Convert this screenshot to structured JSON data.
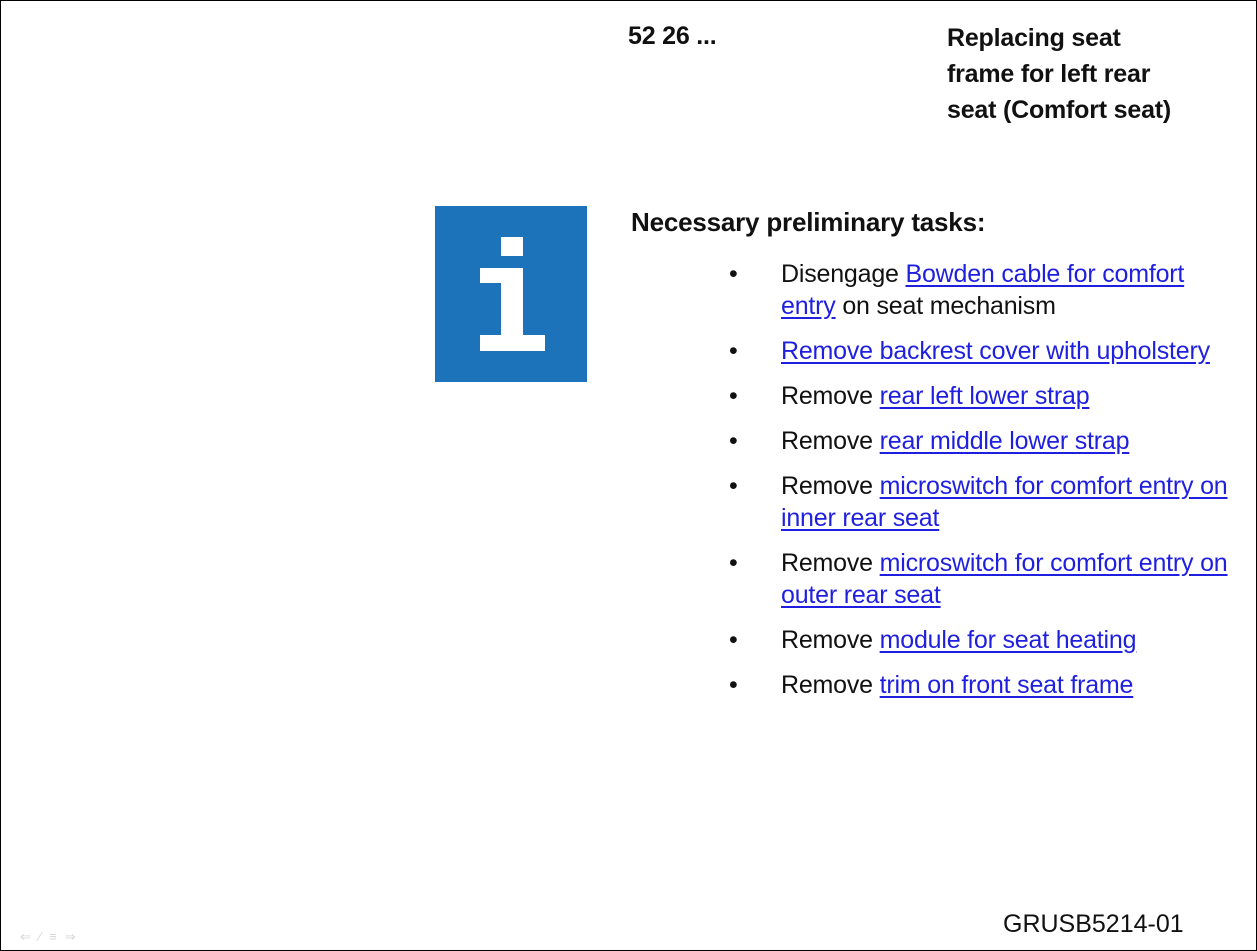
{
  "header": {
    "code": "52 26 ...",
    "title_lines": [
      "Replacing seat",
      "frame for left rear",
      "seat (Comfort seat)"
    ]
  },
  "section": {
    "heading": "Necessary preliminary tasks:",
    "info_icon": "info-icon",
    "bullet": "•",
    "tasks": [
      {
        "prefix": "Disengage ",
        "link": "Bowden cable for comfort entry",
        "suffix": " on seat mechanism"
      },
      {
        "prefix": "",
        "link": "Remove backrest cover with upholstery",
        "suffix": ""
      },
      {
        "prefix": "Remove ",
        "link": "rear left lower strap",
        "suffix": ""
      },
      {
        "prefix": "Remove ",
        "link": "rear middle lower strap",
        "suffix": ""
      },
      {
        "prefix": "Remove ",
        "link": "microswitch for comfort entry on inner rear seat",
        "suffix": ""
      },
      {
        "prefix": "Remove ",
        "link": "microswitch for comfort entry on outer rear seat",
        "suffix": ""
      },
      {
        "prefix": "Remove ",
        "link": "module for seat heating",
        "suffix": ""
      },
      {
        "prefix": "Remove ",
        "link": "trim on front seat frame",
        "suffix": ""
      }
    ]
  },
  "footer": {
    "doc_id": "GRUSB5214-01"
  },
  "nav": {
    "icons": [
      "arrow-left-icon",
      "pen-icon",
      "menu-icon",
      "arrow-right-icon"
    ],
    "glyphs": [
      "⇐",
      "⁄",
      "≡",
      "⇒"
    ]
  },
  "colors": {
    "info_blue": "#1c73b9",
    "link_blue": "#1f1fe0"
  }
}
